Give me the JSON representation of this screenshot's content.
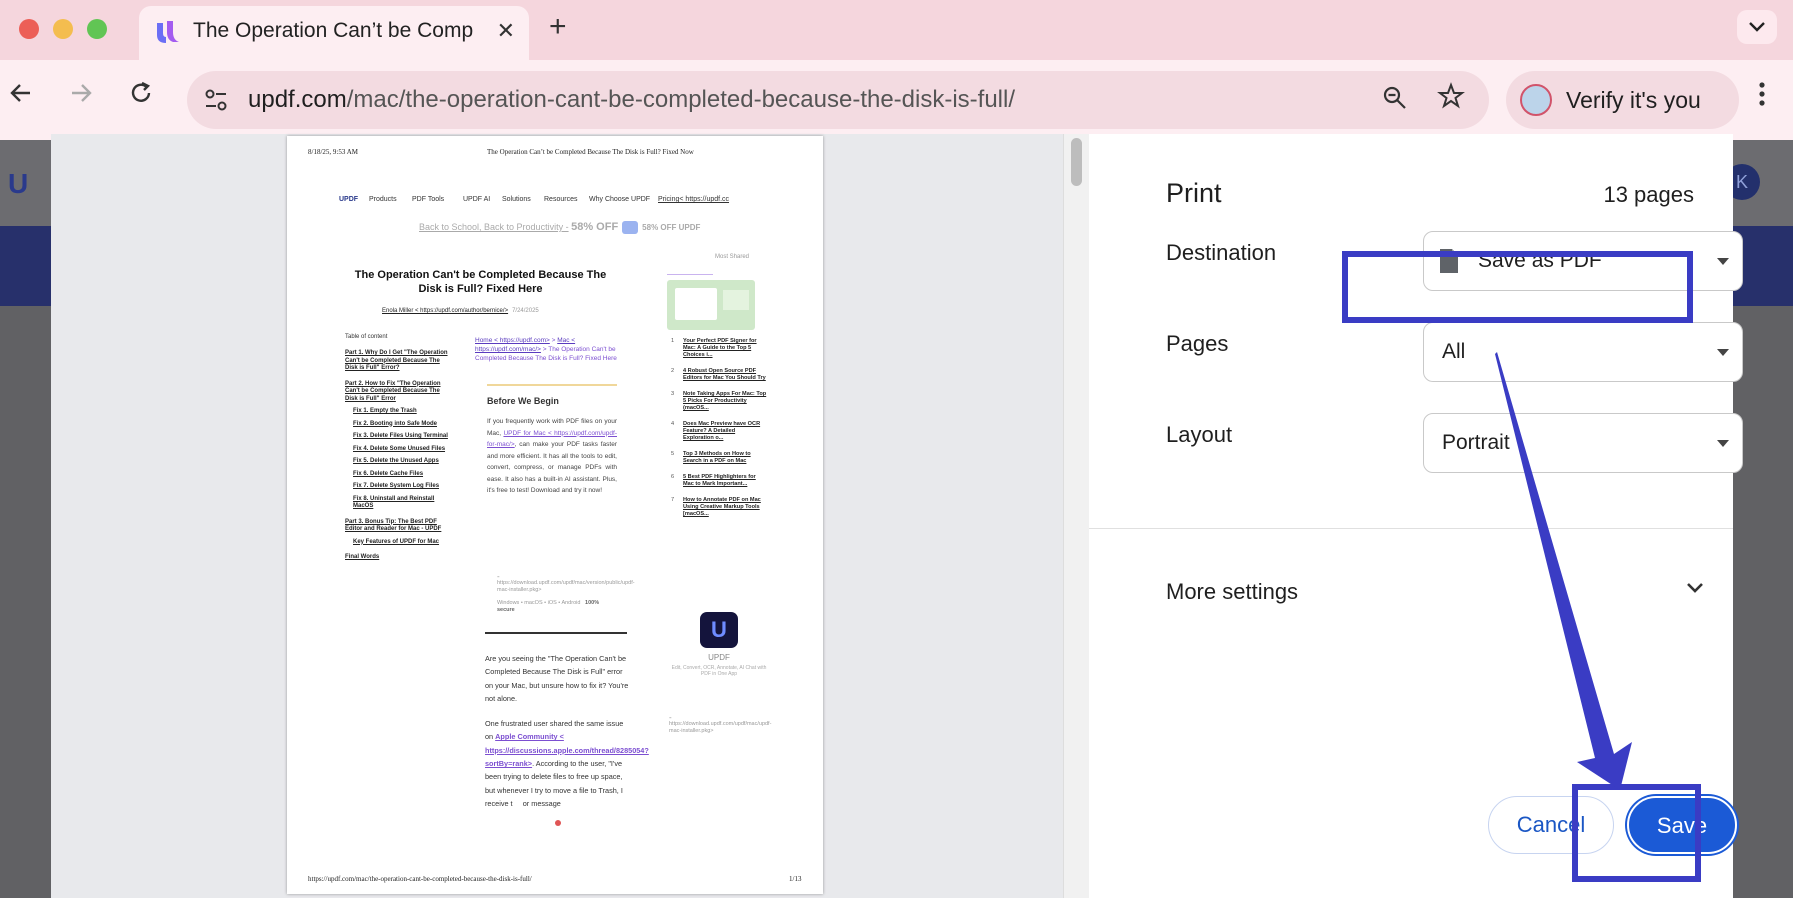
{
  "window": {
    "tab_title": "The Operation Can’t be Comp",
    "new_tab_symbol": "+",
    "url_host": "updf.com",
    "url_path": "/mac/the-operation-cant-be-completed-because-the-disk-is-full/",
    "verify_label": "Verify it's you"
  },
  "icons": {
    "back": "arrow-left-icon",
    "forward": "arrow-right-icon",
    "reload": "reload-icon",
    "zoom": "zoom-icon",
    "bookmark": "star-icon",
    "menu": "kebab-icon",
    "tab_close": "close-icon"
  },
  "colors": {
    "tab_strip": "#f5d6dd",
    "toolbar": "#fdeef2",
    "accent_blue": "#1b5ad6",
    "annotation": "#3a3cc4"
  },
  "page_behind": {
    "avatar_letter": "K"
  },
  "preview": {
    "header_date": "8/18/25, 9:53 AM",
    "header_title": "The Operation Can’t be Completed Because The Disk is Full? Fixed Now",
    "footer_url": "https://updf.com/mac/the-operation-cant-be-completed-because-the-disk-is-full/",
    "footer_page": "1/13",
    "site_nav": {
      "logo": "UPDF",
      "items": [
        "Products",
        "PDF Tools",
        "UPDF AI",
        "Solutions",
        "Resources",
        "Why Choose UPDF"
      ],
      "pricing": "Pricing< https://updf.cc"
    },
    "promo": {
      "text": "Back to School, Back to Productivity -",
      "off": "58% OFF",
      "off_right": "58% OFF UPDF"
    },
    "article_title": "The Operation Can't be Completed Because The Disk is Full? Fixed Here",
    "author": "Enola Miller < https://updf.com/author/bernice/>",
    "date": "7/24/2025",
    "toc_heading": "Table of content",
    "toc": [
      {
        "text": "Part 1. Why Do I Get \"The Operation Can't be Completed Because The Disk is Full\" Error?",
        "sub": false,
        "gap": false
      },
      {
        "text": "Part 2. How to Fix \"The Operation Can't be Completed Because The Disk is Full\" Error",
        "sub": false,
        "gap": true
      },
      {
        "text": "Fix 1. Empty the Trash",
        "sub": true,
        "gap": false
      },
      {
        "text": "Fix 2. Booting into Safe Mode",
        "sub": true,
        "gap": false
      },
      {
        "text": "Fix 3. Delete Files Using Terminal",
        "sub": true,
        "gap": false
      },
      {
        "text": "Fix 4. Delete Some Unused Files",
        "sub": true,
        "gap": false
      },
      {
        "text": "Fix 5. Delete the Unused Apps",
        "sub": true,
        "gap": false
      },
      {
        "text": "Fix 6. Delete Cache Files",
        "sub": true,
        "gap": false
      },
      {
        "text": "Fix 7. Delete System Log Files",
        "sub": true,
        "gap": false
      },
      {
        "text": "Fix 8. Uninstall and Reinstall MacOS",
        "sub": true,
        "gap": false
      },
      {
        "text": "Part 3. Bonus Tip: The Best PDF Editor and Reader for Mac - UPDF",
        "sub": false,
        "gap": true
      },
      {
        "text": "Key Features of UPDF for Mac",
        "sub": true,
        "gap": false
      },
      {
        "text": "Final Words",
        "sub": false,
        "gap": true
      }
    ],
    "breadcrumb_home": "Home < https://updf.com>",
    "breadcrumb_sep": " > ",
    "breadcrumb_mac": "Mac < https://updf.com/mac/>",
    "breadcrumb_rest": " > The Operation Can't be Completed Because The Disk is Full? Fixed Here",
    "before_heading": "Before We Begin",
    "before_text_1": "If you frequently work with PDF files on your Mac,",
    "before_link": "UPDF for Mac < https://updf.com/updf-for-mac/>",
    "before_text_2": ", can make your PDF tasks faster and more efficient. It has all the tools to edit, convert, compress, or manage PDFs with ease. It also has a built-in AI assistant. Plus, it's free to test! Download and try it now!",
    "download_link": "https://download.updf.com/updf/mac/version/public/updf-mac-installer.pkg>",
    "download_os": "Windows • macOS • iOS • Android",
    "download_secure": "100% secure",
    "body_p1": "Are you seeing the \"The Operation Can't be Completed Because The Disk is Full\" error on your Mac, but unsure how to fix it? You're not alone.",
    "body_p2_a": "One frustrated user shared the same issue on",
    "body_p2_link": "Apple Community < https://discussions.apple.com/thread/8285054?sortBy=rank>",
    "body_p2_b": ". According to the user, \"I've been trying to delete files to free up space, but whenever I try to move a file to Trash, I receive t",
    "body_p2_c": "or message",
    "most_shared": "Most Shared",
    "most_shared_items": [
      {
        "n": "1",
        "text": "Your Perfect PDF Signer for Mac: A Guide to the Top 5 Choices i..."
      },
      {
        "n": "2",
        "text": "4 Robust Open Source PDF Editors for Mac You Should Try"
      },
      {
        "n": "3",
        "text": "Note Taking Apps For Mac: Top 5 Picks For Productivity (macOS..."
      },
      {
        "n": "4",
        "text": "Does Mac Preview have OCR Feature? A Detailed Exploration o..."
      },
      {
        "n": "5",
        "text": "Top 3 Methods on How to Search in a PDF on Mac"
      },
      {
        "n": "6",
        "text": "5 Best PDF Highlighters for Mac to Mark Important..."
      },
      {
        "n": "7",
        "text": "How to Annotate PDF on Mac Using Creative Markup Tools [macOS..."
      }
    ],
    "updf_card_name": "UPDF",
    "updf_card_tag": "Edit, Convert, OCR, Annotate, AI Chat with PDF in One App",
    "updf_card_link": "https://download.updf.com/updf/mac/updf-mac-installer.pkg>"
  },
  "print": {
    "title": "Print",
    "page_count": "13 pages",
    "destination_label": "Destination",
    "destination_value": "Save as PDF",
    "pages_label": "Pages",
    "pages_value": "All",
    "layout_label": "Layout",
    "layout_value": "Portrait",
    "more_settings_label": "More settings",
    "cancel_label": "Cancel",
    "save_label": "Save"
  }
}
